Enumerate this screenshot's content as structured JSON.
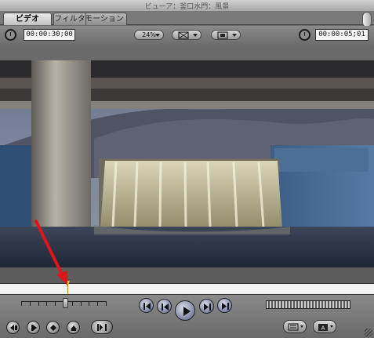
{
  "window": {
    "title": "ビューア：釜口水門：風景"
  },
  "tabs": [
    {
      "label": "ビデオ",
      "active": true
    },
    {
      "label": "フィルタ",
      "active": false
    },
    {
      "label": "モーション",
      "active": false
    }
  ],
  "controls": {
    "duration_timecode": "00:00:30;00",
    "zoom_label": "24%",
    "view_icon": "view-mode-icon",
    "overlay_icon": "overlay-frame-icon",
    "current_timecode": "00:00:05;01"
  },
  "transport": {
    "shuttle_position": 0.52,
    "playhead_position": 0.18,
    "buttons": [
      "go-to-in-icon",
      "step-back-icon",
      "play-icon",
      "step-forward-icon",
      "go-to-out-icon"
    ],
    "edit_buttons": [
      "insert-icon",
      "mark-in-icon",
      "add-marker-icon",
      "mark-out-icon",
      "match-frame-icon"
    ],
    "popup_icons": [
      "recent-clips-icon",
      "generator-icon"
    ]
  },
  "colors": {
    "accent": "#2f3a9a",
    "annotation_arrow": "#e0141b",
    "playhead": "#e7c63a"
  }
}
